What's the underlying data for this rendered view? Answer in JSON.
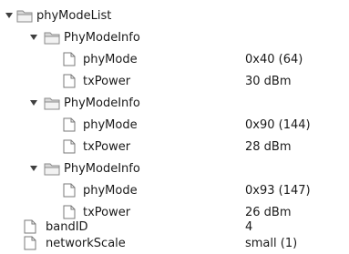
{
  "tree": {
    "root": {
      "label": "phyModeList"
    },
    "groups": [
      {
        "label": "PhyModeInfo",
        "fields": [
          {
            "label": "phyMode",
            "value": "0x40 (64)"
          },
          {
            "label": "txPower",
            "value": "30 dBm"
          }
        ]
      },
      {
        "label": "PhyModeInfo",
        "fields": [
          {
            "label": "phyMode",
            "value": "0x90 (144)"
          },
          {
            "label": "txPower",
            "value": "28 dBm"
          }
        ]
      },
      {
        "label": "PhyModeInfo",
        "fields": [
          {
            "label": "phyMode",
            "value": "0x93 (147)"
          },
          {
            "label": "txPower",
            "value": "26 dBm"
          }
        ]
      }
    ],
    "fields": [
      {
        "label": "bandID",
        "value": "4"
      },
      {
        "label": "networkScale",
        "value": "small (1)"
      }
    ]
  },
  "icons": {
    "folder": "folder-open-icon",
    "file": "file-icon",
    "expander": "expand-arrow-icon"
  },
  "colors": {
    "folder_fill": "#d9d9d9",
    "folder_border": "#8a8a8a",
    "file_fill": "#ffffff",
    "file_border": "#7a7a7a",
    "arrow": "#404040"
  }
}
